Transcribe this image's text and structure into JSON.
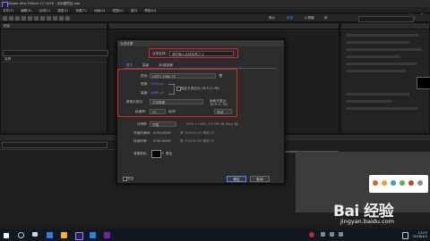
{
  "window": {
    "title": "Adobe After Effects CC 2018 - 无标题项目.aep"
  },
  "menu": [
    "文件(F)",
    "编辑(E)",
    "合成(C)",
    "图层(L)",
    "效果(T)",
    "动画(A)",
    "视图(V)",
    "窗口",
    "帮助(H)"
  ],
  "workspaces": [
    "默认",
    "标准",
    "小屏幕",
    "库"
  ],
  "project_panel": {
    "header": "项目",
    "name_col": "名称"
  },
  "dialog": {
    "title": "合成设置",
    "comp_name_label": "合成名称:",
    "comp_name_value": "请在输入合成名称之上",
    "tabs": [
      "基本",
      "高级",
      "3D渲染器"
    ],
    "preset_label": "预设:",
    "preset_value": "HDTV 1080 25",
    "width_label": "宽度:",
    "width_value": "1920 px",
    "height_label": "高度:",
    "height_value": "1080 px",
    "lock_ratio": "锁定长宽比为 16:9 (1.78)",
    "pixel_aspect_label": "像素长宽比:",
    "pixel_aspect_value": "方形像素",
    "frame_aspect_label": "画面长宽比:",
    "frame_aspect_value": "16:9 (1.78)",
    "frame_rate_label": "帧速率:",
    "frame_rate_value": "25",
    "frame_rate_unit": "帧/秒",
    "drop_frame": "丢帧",
    "resolution_label": "分辨率:",
    "resolution_value": "完整",
    "resolution_info": "1920 x 1080, 7.9 MB (每 8bpc 帧)",
    "start_tc_label": "开始时间码:",
    "start_tc_value": "0:00:00:00",
    "start_tc_note": "是 0:00:00:00 基础 25",
    "duration_label": "持续时间:",
    "duration_value": "0:00:30:00",
    "duration_note": "是 0:00:30:00 基础 25",
    "bg_label": "背景颜色:",
    "bg_value": "黑色",
    "preview_label": "预览",
    "ok": "确定",
    "cancel": "取消"
  },
  "watermark": {
    "logo": "Bai 经验",
    "url": "jingyan.baidu.com"
  },
  "taskbar": {
    "time": "13:07",
    "date": "2018/4/2"
  },
  "colors": {
    "highlight": "#e3232b",
    "accent": "#4d8cf0",
    "bg_swatch": "#000000"
  }
}
